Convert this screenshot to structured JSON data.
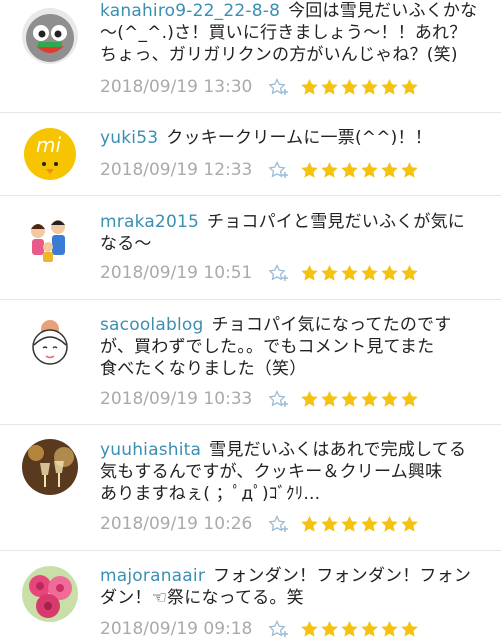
{
  "comments": [
    {
      "username": "kanahiro9-22_22-8-8",
      "lines": [
        "今回は雪見だいふくかな",
        "～(^_^.)さ！買いに行きましょう～！！あれ？",
        "ちょっ、ガリガリクンの方がいんじゃね？(笑)"
      ],
      "date": "2018/09/19 13:30",
      "rating": 6
    },
    {
      "username": "yuki53",
      "lines": [
        "クッキークリームに一票(^^)！！"
      ],
      "date": "2018/09/19 12:33",
      "rating": 6
    },
    {
      "username": "mraka2015",
      "lines": [
        "チョコパイと雪見だいふくが気に",
        "なる～"
      ],
      "date": "2018/09/19 10:51",
      "rating": 6
    },
    {
      "username": "sacoolablog",
      "lines": [
        "チョコパイ気になってたのです",
        "が、買わずでした。。でもコメント見てまた",
        "食べたくなりました（笑）"
      ],
      "date": "2018/09/19 10:33",
      "rating": 6
    },
    {
      "username": "yuuhiashita",
      "lines": [
        "雪見だいふくはあれで完成してる",
        "気もするんですが、クッキー＆クリーム興味",
        "ありますねぇ( ；ﾟдﾟ)ｺﾞｸﾘ..."
      ],
      "date": "2018/09/19 10:26",
      "rating": 6
    },
    {
      "username": "majoranaair",
      "lines": [
        "フォンダン！フォンダン！フォン",
        "ダン！☜祭になってる。笑"
      ],
      "date": "2018/09/19 09:18",
      "rating": 6
    }
  ],
  "colors": {
    "username": "#3a8fb3",
    "date": "#aaaaaa",
    "star": "#f5c20f",
    "fav_icon": "#9bbcd6"
  },
  "icons": {
    "rating": "star-icon",
    "favorite": "favorite-star-plus-icon"
  }
}
